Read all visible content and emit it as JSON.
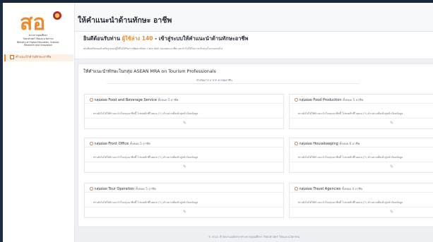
{
  "brand": {
    "logo_mark": "สอ",
    "line1": "ทรวงการอุดมศึกษา",
    "line2": "วิทยาศาสตร์ วิจัยและนวัตกรรม",
    "line3": "Ministry of Higher Education, Science, Research and Innovation"
  },
  "sidebar": {
    "items": [
      {
        "label": "คำแนะนำด้านทักษะอาชีพ",
        "icon": "book-icon",
        "active": true
      }
    ]
  },
  "header": {
    "title": "ให้คำแนะนำด้านทักษะ อาชีพ"
  },
  "welcome": {
    "prefix": "ยินดีต้อนรับท่าน",
    "user": "ผู้ใช้ล่าง 140",
    "suffix": "- เข้าสู่ระบบให้คำแนะนำด้านทักษะอาชีพ",
    "description": "ทรงคิดสรัปทองสำหรับรูปแบบผู้ใช้ไม่ได้รับการพัฒนาทักษะ Core Skill ของแต่ละอาชีพ และนำไปใช้ในการปรับปรุงในระบบต่อไป"
  },
  "panel": {
    "title": "ให้คำแนะนำทักษะในกลุ่ม ASEAN MRA on Tourism Professionals",
    "count_text": "ดำเนินการ 0 จาก 6 กลุ่มอาชีพ"
  },
  "groups": [
    {
      "prefix": "กลุ่มย่อย",
      "name": "Food and Beverage Service",
      "count": "ทั้งหมด 5 อาชีพ"
    },
    {
      "prefix": "กลุ่มย่อย",
      "name": "Food Production",
      "count": "ทั้งหมด 5 อาชีพ"
    },
    {
      "prefix": "กลุ่มย่อย",
      "name": "Front Office",
      "count": "ทั้งหมด 5 อาชีพ"
    },
    {
      "prefix": "กลุ่มย่อย",
      "name": "Housekeeping",
      "count": "ทั้งหมด 6 อาชีพ"
    },
    {
      "prefix": "กลุ่มย่อย",
      "name": "Tour Operation",
      "count": "ทั้งหมด 5 อาชีพ"
    },
    {
      "prefix": "กลุ่มย่อย",
      "name": "Travel Agencies",
      "count": "ทั้งหมด 4 อาชีพ"
    }
  ],
  "card_note": "ท่านยังไม่ได้ให้คำแนะนำในกลุ่มอาชีพนี้ โปรดคลิกที่ไอคอน (✎) ด้านล่างเพื่อเข้าสู่หน้าป้อนข้อมูล",
  "edit_icon": "pencil-icon",
  "footer": {
    "text": "© 2022 สำนักงานปลัดกระทรวงการอุดมศึกษา วิทยาศาสตร์ วิจัยและนวัตกรรม"
  },
  "colors": {
    "accent": "#f08a24",
    "frame": "#1c2d44",
    "text": "#2a2f38"
  }
}
